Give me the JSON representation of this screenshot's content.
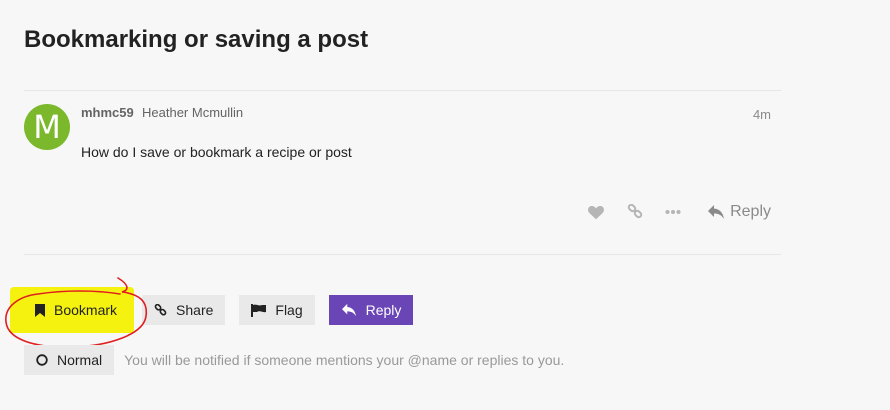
{
  "topic": {
    "title": "Bookmarking or saving a post"
  },
  "post": {
    "avatar_letter": "M",
    "username": "mhmc59",
    "full_name": "Heather Mcmullin",
    "age": "4m",
    "body": "How do I save or bookmark a recipe or post",
    "actions": {
      "reply_label": "Reply"
    }
  },
  "footer": {
    "bookmark_label": "Bookmark",
    "share_label": "Share",
    "flag_label": "Flag",
    "reply_label": "Reply"
  },
  "notifications": {
    "level_label": "Normal",
    "description": "You will be notified if someone mentions your @name or replies to you."
  },
  "colors": {
    "avatar": "#7bb82c",
    "primary": "#6a45b5",
    "highlight": "#f5f20f",
    "annotation": "#e02020"
  }
}
